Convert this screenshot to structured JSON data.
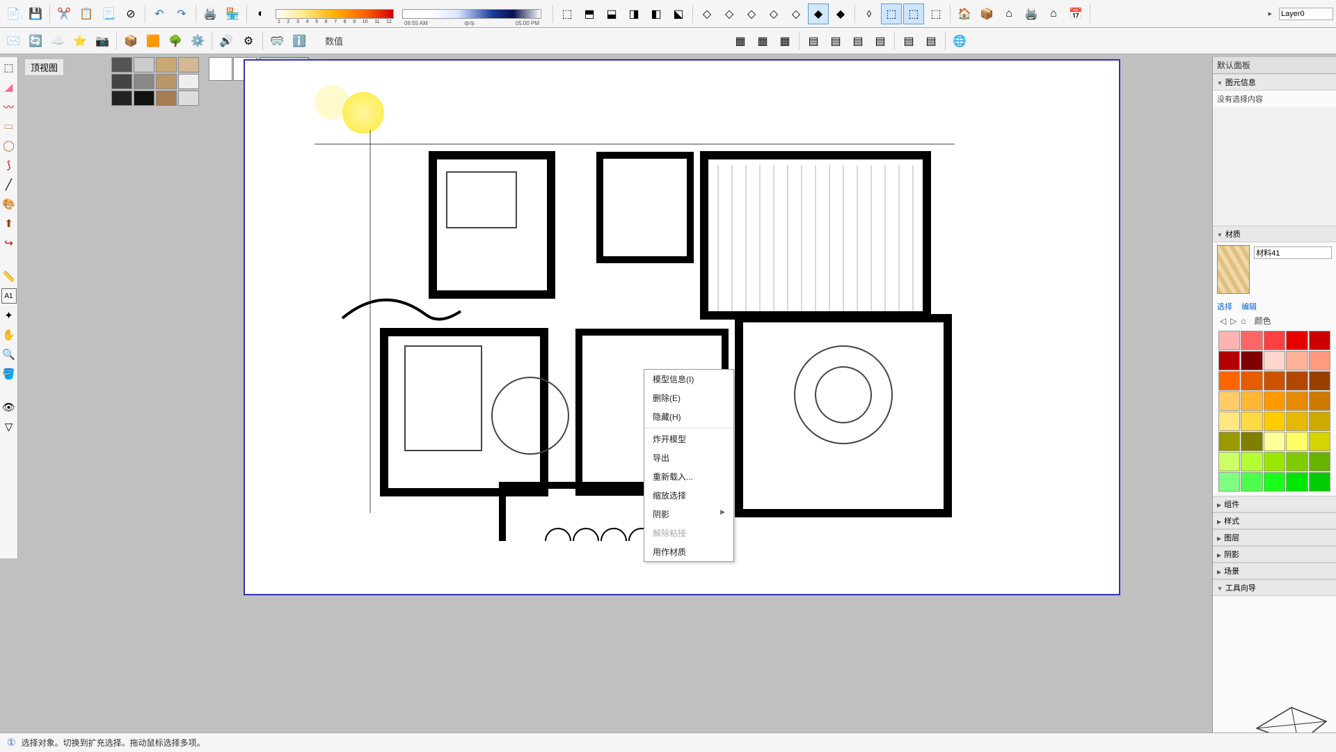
{
  "top_toolbar": {
    "time_stops": [
      "1",
      "2",
      "3",
      "4",
      "5",
      "6",
      "7",
      "8",
      "9",
      "10",
      "11",
      "12"
    ],
    "time_start": "06:55 AM",
    "time_mid": "中午",
    "time_end": "05:00 PM"
  },
  "layer_label": "Layer0",
  "second_toolbar": {
    "value_label": "数值"
  },
  "view_label": "顶视图",
  "context_menu": {
    "items": [
      {
        "label": "模型信息(I)",
        "enabled": true
      },
      {
        "label": "删除(E)",
        "enabled": true
      },
      {
        "label": "隐藏(H)",
        "enabled": true
      },
      {
        "sep": true
      },
      {
        "label": "炸开模型",
        "enabled": true
      },
      {
        "label": "导出",
        "enabled": true
      },
      {
        "label": "重新载入...",
        "enabled": true
      },
      {
        "label": "缩放选择",
        "enabled": true
      },
      {
        "label": "阴影",
        "enabled": true,
        "submenu": true
      },
      {
        "label": "解除粘接",
        "enabled": false
      },
      {
        "label": "用作材质",
        "enabled": true
      }
    ]
  },
  "right_panel": {
    "default_panel": "默认面板",
    "element_info": "图元信息",
    "no_selection": "没有选择内容",
    "material": "材质",
    "material_name": "材料41",
    "select_tab": "选择",
    "edit_tab": "编辑",
    "color_label": "颜色",
    "sections": [
      "组件",
      "样式",
      "图层",
      "阴影",
      "场景",
      "工具向导"
    ]
  },
  "color_swatches": [
    "#ffb3b3",
    "#ff6666",
    "#ff4040",
    "#e60000",
    "#cc0000",
    "#b30000",
    "#800000",
    "#ffd6cc",
    "#ffb399",
    "#ff9980",
    "#ff6600",
    "#e65c00",
    "#cc5200",
    "#b34700",
    "#994000",
    "#ffcc66",
    "#ffb733",
    "#ff9900",
    "#e68a00",
    "#cc7a00",
    "#ffe680",
    "#ffd940",
    "#ffcc00",
    "#e6b800",
    "#ccaa00",
    "#999900",
    "#808000",
    "#ffff99",
    "#ffff66",
    "#d4d400",
    "#ccff66",
    "#b3ff33",
    "#99e600",
    "#80cc00",
    "#66b300",
    "#80ff80",
    "#4dff4d",
    "#1aff1a",
    "#00e600",
    "#00cc00"
  ],
  "statusbar": {
    "help_icon": "①",
    "text": "选择对象。切换到扩充选择。拖动鼠标选择多项。"
  }
}
